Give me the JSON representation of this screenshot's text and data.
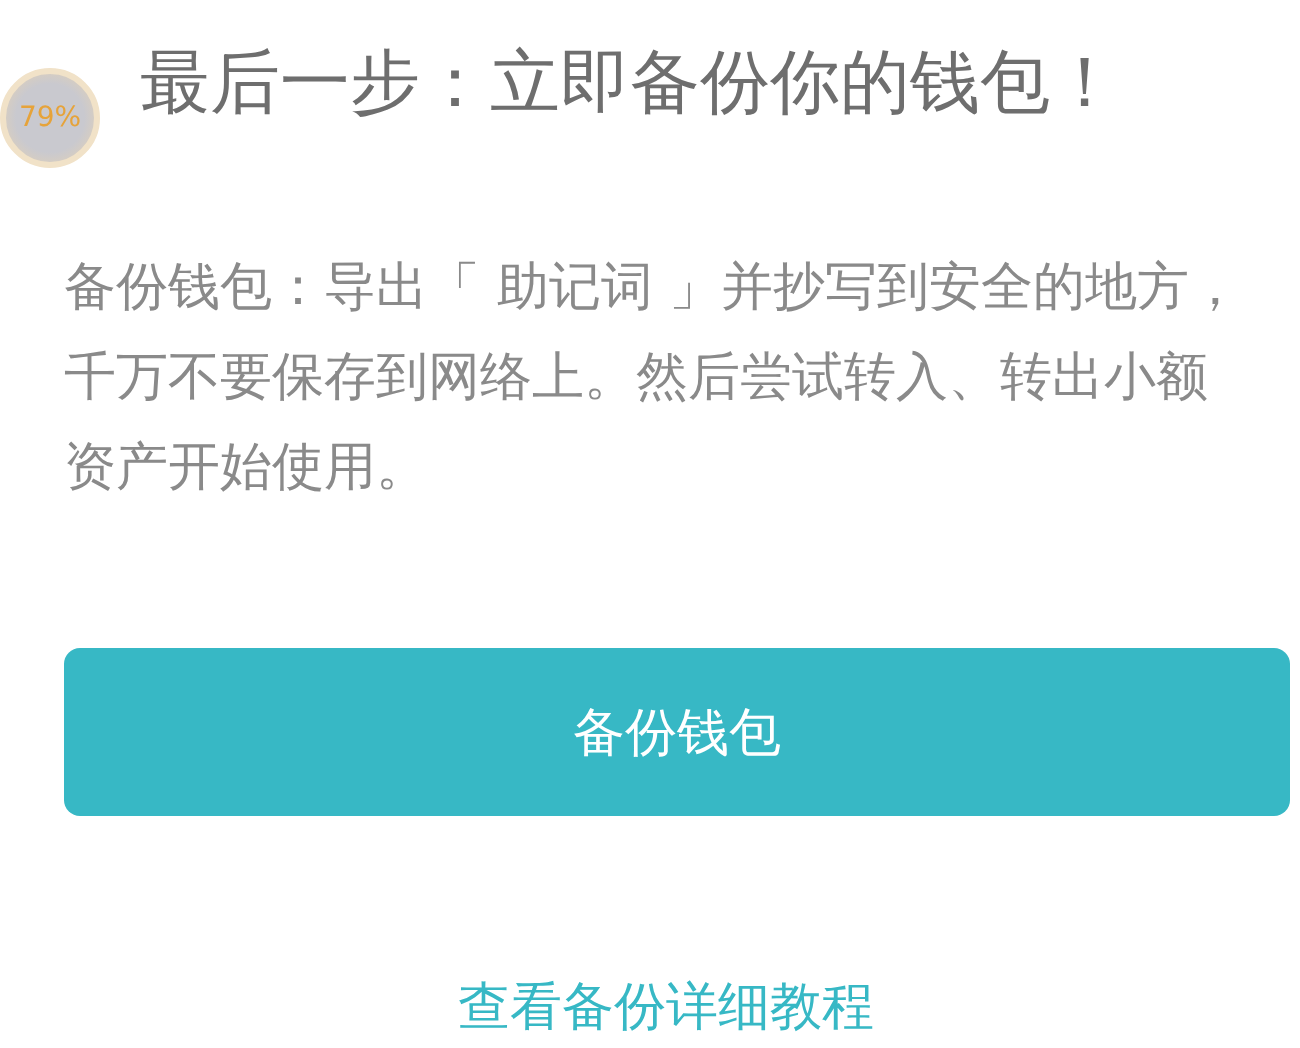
{
  "badge": {
    "text": "79%"
  },
  "title": "最后一步：立即备份你的钱包！",
  "description": "备份钱包：导出「 助记词 」并抄写到安全的地方，千万不要保存到网络上。然后尝试转入、转出小额资产开始使用。",
  "primary_button": "备份钱包",
  "tutorial_link": "查看备份详细教程"
}
